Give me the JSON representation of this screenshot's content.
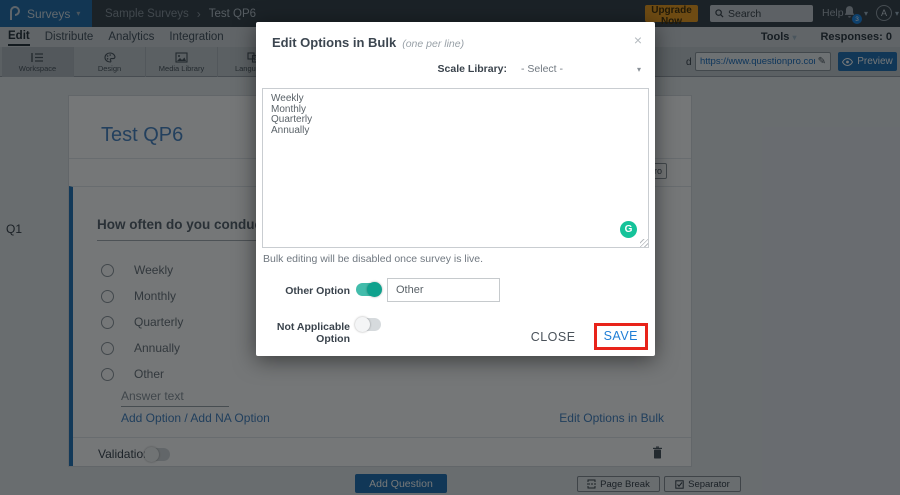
{
  "topbar": {
    "product_name": "Surveys",
    "breadcrumb": {
      "parent": "Sample Surveys",
      "separator": "›",
      "current": "Test QP6"
    },
    "upgrade_button": "Upgrade Now",
    "search_placeholder": "Search",
    "help_label": "Help",
    "notification_count": "3",
    "avatar_letter": "A"
  },
  "menubar": {
    "items": {
      "edit": "Edit",
      "distribute": "Distribute",
      "analytics": "Analytics",
      "integration": "Integration"
    },
    "tools_label": "Tools",
    "responses_label": "Responses: 0"
  },
  "toolbar": {
    "tabs": {
      "workspace": "Workspace",
      "design": "Design",
      "media_library": "Media Library",
      "languages": "Languages"
    },
    "left_text_fragment": "d",
    "survey_url": "https://www.questionpro.com/t/APNrfZ",
    "preview_label": "Preview"
  },
  "survey": {
    "question_number": "Q1",
    "title": "Test QP6",
    "partial_button_fragment": "ro",
    "question_text": "How often do you conduct the",
    "options": [
      "Weekly",
      "Monthly",
      "Quarterly",
      "Annually",
      "Other"
    ],
    "answer_placeholder": "Answer text",
    "add_option_link": "Add Option",
    "link_separator": "/",
    "add_na_link": "Add NA Option",
    "edit_bulk_link": "Edit Options in Bulk",
    "validation_label": "Validation",
    "add_question_button": "Add Question",
    "page_break_button": "Page Break",
    "separator_button": "Separator"
  },
  "modal": {
    "title": "Edit Options in Bulk",
    "subtitle": "(one per line)",
    "close_icon": "×",
    "scale_library_label": "Scale Library:",
    "scale_library_value": "- Select -",
    "textarea_value": "Weekly\nMonthly\nQuarterly\nAnnually",
    "grammarly_letter": "G",
    "note": "Bulk editing will be disabled once survey is live.",
    "other_option_label": "Other Option",
    "other_option_value": "Other",
    "na_option_label": "Not Applicable Option",
    "close_button": "CLOSE",
    "save_button": "SAVE"
  },
  "colors": {
    "accent_blue": "#1b87e6",
    "toggle_on_teal": "#42bcab",
    "grammarly_green": "#15c39a",
    "save_highlight_red": "#e8231a",
    "upgrade_orange": "#f09d1f"
  }
}
